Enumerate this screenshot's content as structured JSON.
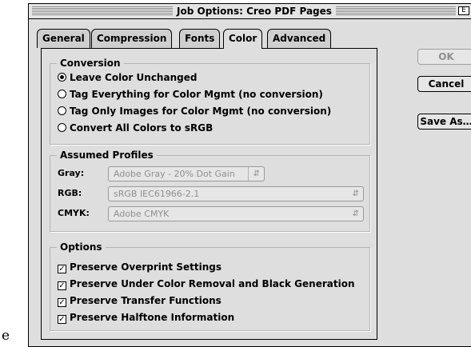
{
  "stray_char": "e",
  "window": {
    "title": "Job Options: Creo PDF Pages",
    "zoom_glyph": "E"
  },
  "tabs": [
    {
      "label": "General",
      "active": false
    },
    {
      "label": "Compression",
      "active": false
    },
    {
      "label": "Fonts",
      "active": false
    },
    {
      "label": "Color",
      "active": true
    },
    {
      "label": "Advanced",
      "active": false
    }
  ],
  "conversion": {
    "title": "Conversion",
    "options": [
      {
        "label": "Leave Color Unchanged",
        "selected": true
      },
      {
        "label": "Tag Everything for Color Mgmt (no conversion)",
        "selected": false
      },
      {
        "label": "Tag Only Images for Color Mgmt (no conversion)",
        "selected": false
      },
      {
        "label": "Convert All Colors to sRGB",
        "selected": false
      }
    ]
  },
  "profiles": {
    "title": "Assumed Profiles",
    "gray": {
      "label": "Gray:",
      "value": "Adobe Gray - 20% Dot Gain"
    },
    "rgb": {
      "label": "RGB:",
      "value": "sRGB IEC61966-2.1"
    },
    "cmyk": {
      "label": "CMYK:",
      "value": "Adobe CMYK"
    },
    "enabled": false
  },
  "options": {
    "title": "Options",
    "items": [
      {
        "label": "Preserve Overprint Settings",
        "checked": true
      },
      {
        "label": "Preserve Under Color Removal and Black Generation",
        "checked": true
      },
      {
        "label": "Preserve Transfer Functions",
        "checked": true
      },
      {
        "label": "Preserve Halftone Information",
        "checked": true
      }
    ]
  },
  "buttons": {
    "ok": "OK",
    "ok_enabled": false,
    "cancel": "Cancel",
    "save_as": "Save As…"
  }
}
